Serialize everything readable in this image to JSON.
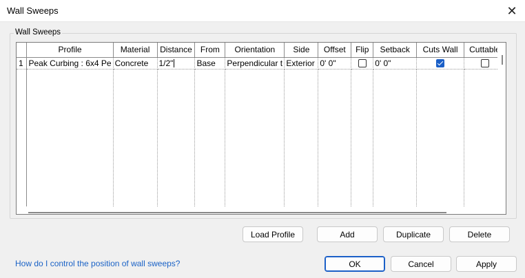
{
  "window": {
    "title": "Wall Sweeps"
  },
  "group": {
    "label": "Wall Sweeps"
  },
  "table": {
    "columns": [
      "",
      "Profile",
      "Material",
      "Distance",
      "From",
      "Orientation",
      "Side",
      "Offset",
      "Flip",
      "Setback",
      "Cuts Wall",
      "Cuttable"
    ],
    "rows": [
      {
        "num": "1",
        "profile": "Peak Curbing : 6x4 Pe",
        "material": "Concrete",
        "distance": "1/2\"",
        "from": "Base",
        "orientation": "Perpendicular t",
        "side": "Exterior",
        "offset": "0'  0\"",
        "flip": false,
        "setback": "0'  0\"",
        "cuts_wall": true,
        "cuttable": false
      }
    ]
  },
  "buttons": {
    "load_profile": "Load Profile",
    "add": "Add",
    "duplicate": "Duplicate",
    "delete": "Delete",
    "ok": "OK",
    "cancel": "Cancel",
    "apply": "Apply"
  },
  "help": {
    "link": "How do I control the position of wall sweeps?"
  },
  "icons": {
    "close": "close-icon",
    "checkbox_checked": "checkbox-checked-icon",
    "checkbox_unchecked": "checkbox-unchecked-icon"
  },
  "colors": {
    "accent": "#1a5fc7",
    "link": "#1a62c6"
  }
}
